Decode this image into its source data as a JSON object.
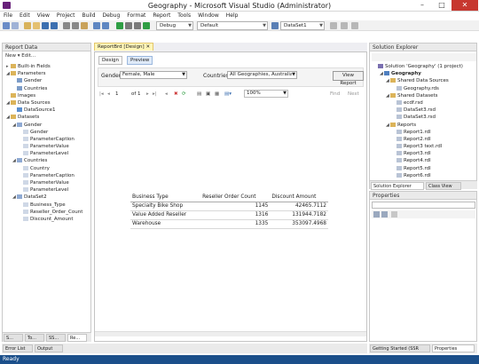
{
  "window": {
    "title": "Geography - Microsoft Visual Studio (Administrator)"
  },
  "menu": [
    "File",
    "Edit",
    "View",
    "Project",
    "Build",
    "Debug",
    "Format",
    "Report",
    "Tools",
    "Window",
    "Help"
  ],
  "toolbar": {
    "config": "Debug",
    "platform": "Default",
    "dataset": "DataSet1"
  },
  "report_data": {
    "title": "Report Data",
    "actions": "New ▾  Edit...",
    "tree": [
      {
        "label": "Built-in Fields",
        "indent": 0,
        "exp": "▸",
        "kind": "folder"
      },
      {
        "label": "Parameters",
        "indent": 0,
        "exp": "◢",
        "kind": "folder"
      },
      {
        "label": "Gender",
        "indent": 1,
        "exp": "",
        "kind": "param"
      },
      {
        "label": "Countries",
        "indent": 1,
        "exp": "",
        "kind": "param"
      },
      {
        "label": "Images",
        "indent": 0,
        "exp": "",
        "kind": "folder"
      },
      {
        "label": "Data Sources",
        "indent": 0,
        "exp": "◢",
        "kind": "folder"
      },
      {
        "label": "DataSource1",
        "indent": 1,
        "exp": "",
        "kind": "ds"
      },
      {
        "label": "Datasets",
        "indent": 0,
        "exp": "◢",
        "kind": "folder"
      },
      {
        "label": "Gender",
        "indent": 1,
        "exp": "◢",
        "kind": "table"
      },
      {
        "label": "Gender",
        "indent": 2,
        "exp": "",
        "kind": "field"
      },
      {
        "label": "ParameterCaption",
        "indent": 2,
        "exp": "",
        "kind": "field"
      },
      {
        "label": "ParameterValue",
        "indent": 2,
        "exp": "",
        "kind": "field"
      },
      {
        "label": "ParameterLevel",
        "indent": 2,
        "exp": "",
        "kind": "field"
      },
      {
        "label": "Countries",
        "indent": 1,
        "exp": "◢",
        "kind": "table"
      },
      {
        "label": "Country",
        "indent": 2,
        "exp": "",
        "kind": "field"
      },
      {
        "label": "ParameterCaption",
        "indent": 2,
        "exp": "",
        "kind": "field"
      },
      {
        "label": "ParameterValue",
        "indent": 2,
        "exp": "",
        "kind": "field"
      },
      {
        "label": "ParameterLevel",
        "indent": 2,
        "exp": "",
        "kind": "field"
      },
      {
        "label": "DataSet2",
        "indent": 1,
        "exp": "◢",
        "kind": "table"
      },
      {
        "label": "Business_Type",
        "indent": 2,
        "exp": "",
        "kind": "field"
      },
      {
        "label": "Reseller_Order_Count",
        "indent": 2,
        "exp": "",
        "kind": "field"
      },
      {
        "label": "Discount_Amount",
        "indent": 2,
        "exp": "",
        "kind": "field"
      }
    ],
    "bottom_tabs": [
      "S...",
      "To...",
      "SS...",
      "Re..."
    ]
  },
  "doc": {
    "tab": "ReportBrd [Design]",
    "subtabs": [
      "Design",
      "Preview"
    ],
    "gender_label": "Gender",
    "gender_value": "Female, Male",
    "countries_label": "Countries",
    "countries_value": "All Geographies, Australia, Car",
    "view_report": "View Report",
    "page_num": "1",
    "page_of": "of 1",
    "zoom": "100%",
    "find": "Find",
    "next": "Next"
  },
  "report_table": {
    "headers": [
      "Business Type",
      "Reseller Order Count",
      "Discount Amount"
    ],
    "rows": [
      [
        "Specialty Bike Shop",
        "1145",
        "42465.7112"
      ],
      [
        "Value Added Reseller",
        "1316",
        "131944.7182"
      ],
      [
        "Warehouse",
        "1335",
        "353097.4968"
      ]
    ]
  },
  "solution_explorer": {
    "title": "Solution Explorer",
    "tree": [
      {
        "label": "Solution 'Geography' (1 project)",
        "indent": 0,
        "exp": "",
        "kind": "sln"
      },
      {
        "label": "Geography",
        "indent": 1,
        "exp": "◢",
        "kind": "proj",
        "bold": true
      },
      {
        "label": "Shared Data Sources",
        "indent": 2,
        "exp": "◢",
        "kind": "folder"
      },
      {
        "label": "Geography.rds",
        "indent": 3,
        "exp": "",
        "kind": "file"
      },
      {
        "label": "Shared Datasets",
        "indent": 2,
        "exp": "◢",
        "kind": "folder"
      },
      {
        "label": "ecdf.rsd",
        "indent": 3,
        "exp": "",
        "kind": "file"
      },
      {
        "label": "DataSet3.rsd",
        "indent": 3,
        "exp": "",
        "kind": "file"
      },
      {
        "label": "DataSet3.rsd",
        "indent": 3,
        "exp": "",
        "kind": "file"
      },
      {
        "label": "Reports",
        "indent": 2,
        "exp": "◢",
        "kind": "folder"
      },
      {
        "label": "Report1.rdl",
        "indent": 3,
        "exp": "",
        "kind": "file"
      },
      {
        "label": "Report2.rdl",
        "indent": 3,
        "exp": "",
        "kind": "file"
      },
      {
        "label": "Report3 text.rdl",
        "indent": 3,
        "exp": "",
        "kind": "file"
      },
      {
        "label": "Report3.rdl",
        "indent": 3,
        "exp": "",
        "kind": "file"
      },
      {
        "label": "Report4.rdl",
        "indent": 3,
        "exp": "",
        "kind": "file"
      },
      {
        "label": "Report5.rdl",
        "indent": 3,
        "exp": "",
        "kind": "file"
      },
      {
        "label": "Report6.rdl",
        "indent": 3,
        "exp": "",
        "kind": "file"
      }
    ],
    "tabs": [
      "Solution Explorer",
      "Class View"
    ]
  },
  "properties": {
    "title": "Properties",
    "bottom_tabs": [
      "Getting Started (SSR",
      "Properties"
    ]
  },
  "bottom": {
    "tabs": [
      "Error List",
      "Output"
    ]
  },
  "status": {
    "text": "Ready"
  },
  "colors": {
    "accent": "#1b4f8a",
    "tabActive": "#fff6b8",
    "folder": "#dcb45a"
  }
}
